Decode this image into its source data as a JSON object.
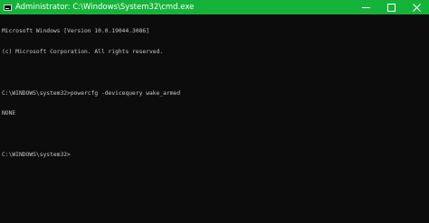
{
  "window": {
    "title": "Administrator: C:\\Windows\\System32\\cmd.exe",
    "titlebar_color": "#16b33a",
    "icons": {
      "app": "cmd-icon",
      "minimize": "minimize-icon",
      "maximize": "maximize-icon",
      "close": "close-icon"
    }
  },
  "console": {
    "lines": [
      "Microsoft Windows [Version 10.0.19044.3086]",
      "(c) Microsoft Corporation. All rights reserved.",
      "",
      "C:\\WINDOWS\\system32>powercfg -devicequery wake_armed",
      "NONE",
      "",
      "C:\\WINDOWS\\system32>"
    ],
    "text_color": "#c8c8c8",
    "background": "#0c0c0c"
  }
}
